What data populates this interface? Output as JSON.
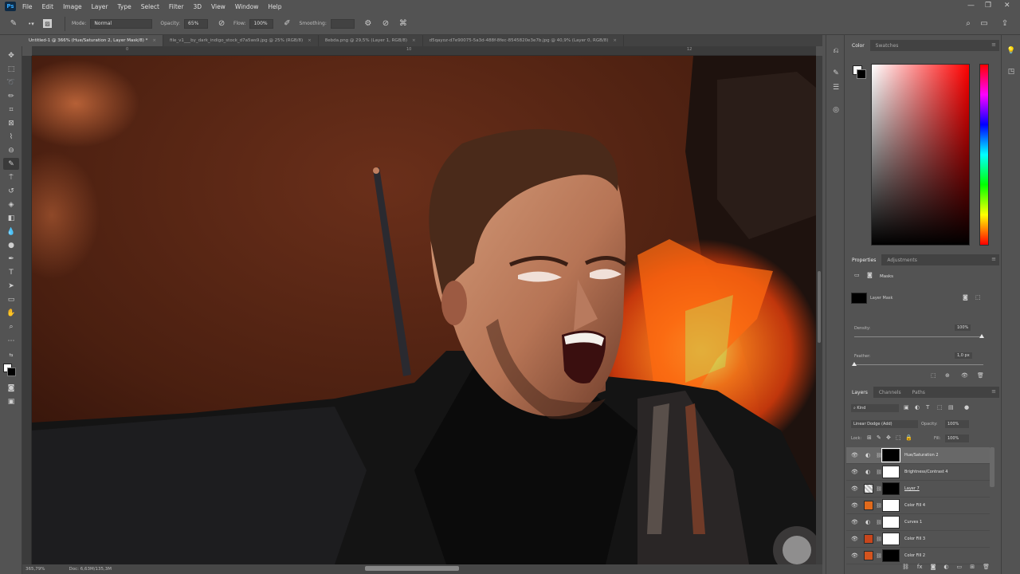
{
  "app": {
    "logo_text": "Ps",
    "menu": [
      "File",
      "Edit",
      "Image",
      "Layer",
      "Type",
      "Select",
      "Filter",
      "3D",
      "View",
      "Window",
      "Help"
    ],
    "window_controls": [
      "—",
      "❐",
      "✕"
    ]
  },
  "options_bar": {
    "mode_label": "Mode:",
    "mode_value": "Normal",
    "opacity_label": "Opacity:",
    "opacity_value": "65%",
    "flow_label": "Flow:",
    "flow_value": "100%",
    "smoothing_label": "Smoothing:",
    "smoothing_value": ""
  },
  "tabs": [
    {
      "label": "Untitled-1 @ 366% (Hue/Saturation 2, Layer Mask/8) *",
      "active": true
    },
    {
      "label": "file_v1___by_dark_indigo_stock_d7a5ws9.jpg @ 25% (RGB/8)",
      "active": false
    },
    {
      "label": "8ebda.png @ 29,5% (Layer 1, RGB/8)",
      "active": false
    },
    {
      "label": "d5qayoz-d7e90075-5a3d-488f-8fec-8545820e3e7b.jpg @ 40,9% (Layer 0, RGB/8)",
      "active": false
    }
  ],
  "ruler": {
    "top_labels": [
      "0",
      "10",
      "12"
    ],
    "left_labels": []
  },
  "status": {
    "zoom": "365,79%",
    "doc": "Doc: 6,63M/135,3M"
  },
  "color_panel": {
    "tabs": [
      "Color",
      "Swatches"
    ],
    "colors": {
      "foreground": "#ffffff",
      "background": "#000000",
      "hue": "#ff0000"
    }
  },
  "properties_panel": {
    "tabs": [
      "Properties",
      "Adjustments"
    ],
    "section": "Masks",
    "mask_label": "Layer Mask",
    "density_label": "Density:",
    "density_value": "100%",
    "feather_label": "Feather:",
    "feather_value": "1,0 px"
  },
  "layers_panel": {
    "tabs": [
      "Layers",
      "Channels",
      "Paths"
    ],
    "filter_label": "Kind",
    "blend_mode": "Linear Dodge (Add)",
    "opacity_label": "Opacity:",
    "opacity_value": "100%",
    "lock_label": "Lock:",
    "fill_label": "Fill:",
    "fill_value": "100%",
    "layers": [
      {
        "name": "Hue/Saturation 2",
        "type": "adjustment",
        "thumb": "#000000",
        "selected": true
      },
      {
        "name": "Brightness/Contrast 4",
        "type": "adjustment",
        "thumb": "#ffffff",
        "selected": false
      },
      {
        "name": "Layer 7",
        "type": "pixel",
        "thumb": "#000000",
        "selected": false
      },
      {
        "name": "Color Fill 4",
        "type": "fill",
        "thumb": "#ffffff",
        "swatch": "#e06a1c",
        "selected": false
      },
      {
        "name": "Curves 1",
        "type": "adjustment",
        "thumb": "#ffffff",
        "selected": false
      },
      {
        "name": "Color Fill 3",
        "type": "fill",
        "thumb": "#ffffff",
        "swatch": "#c8461c",
        "selected": false
      },
      {
        "name": "Color Fill 2",
        "type": "fill",
        "thumb": "#000000",
        "swatch": "#d4541e",
        "selected": false
      }
    ]
  }
}
